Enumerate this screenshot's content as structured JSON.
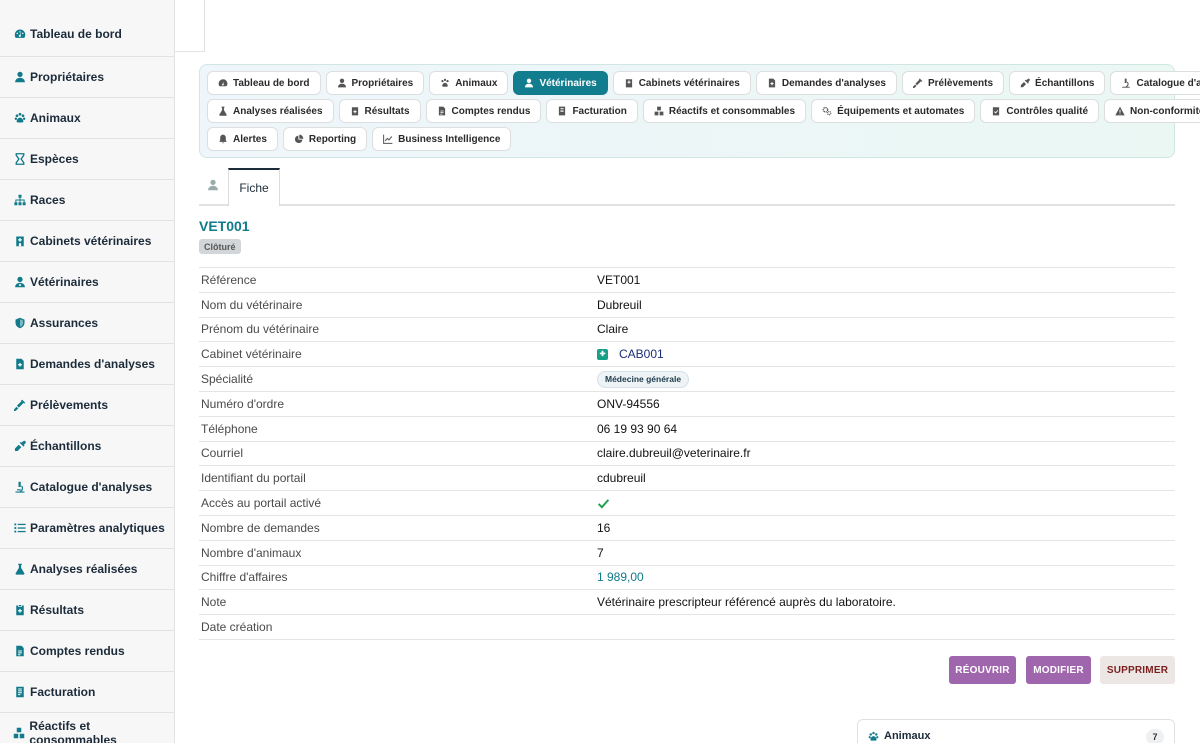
{
  "sidebar": {
    "items": [
      {
        "label": "Tableau de bord",
        "icon": "gauge-icon"
      },
      {
        "label": "Propriétaires",
        "icon": "user-icon"
      },
      {
        "label": "Animaux",
        "icon": "paw-icon"
      },
      {
        "label": "Espèces",
        "icon": "hourglass-icon"
      },
      {
        "label": "Races",
        "icon": "sitemap-icon"
      },
      {
        "label": "Cabinets vétérinaires",
        "icon": "clinic-icon"
      },
      {
        "label": "Vétérinaires",
        "icon": "user-doctor-icon"
      },
      {
        "label": "Assurances",
        "icon": "shield-icon"
      },
      {
        "label": "Demandes d'analyses",
        "icon": "file-medical-icon"
      },
      {
        "label": "Prélèvements",
        "icon": "syringe-icon"
      },
      {
        "label": "Échantillons",
        "icon": "eyedropper-icon"
      },
      {
        "label": "Catalogue d'analyses",
        "icon": "microscope-icon"
      },
      {
        "label": "Paramètres analytiques",
        "icon": "list-icon"
      },
      {
        "label": "Analyses réalisées",
        "icon": "flask-icon"
      },
      {
        "label": "Résultats",
        "icon": "file-result-icon"
      },
      {
        "label": "Comptes rendus",
        "icon": "file-report-icon"
      },
      {
        "label": "Facturation",
        "icon": "invoice-icon"
      },
      {
        "label": "Réactifs et consommables",
        "icon": "boxes-icon"
      }
    ]
  },
  "nav": {
    "rows": [
      [
        {
          "label": "Tableau de bord",
          "icon": "gauge-icon",
          "active": false
        },
        {
          "label": "Propriétaires",
          "icon": "user-icon",
          "active": false
        },
        {
          "label": "Animaux",
          "icon": "paw-icon",
          "active": false
        },
        {
          "label": "Vétérinaires",
          "icon": "user-doctor-icon",
          "active": true
        },
        {
          "label": "Cabinets vétérinaires",
          "icon": "clinic-icon",
          "active": false
        },
        {
          "label": "Demandes d'analyses",
          "icon": "file-medical-icon",
          "active": false
        },
        {
          "label": "Prélèvements",
          "icon": "syringe-icon",
          "active": false
        },
        {
          "label": "Échantillons",
          "icon": "eyedropper-icon",
          "active": false
        },
        {
          "label": "Catalogue d'analyses",
          "icon": "microscope-icon",
          "active": false
        }
      ],
      [
        {
          "label": "Analyses réalisées",
          "icon": "flask-icon",
          "active": false
        },
        {
          "label": "Résultats",
          "icon": "file-result-icon",
          "active": false
        },
        {
          "label": "Comptes rendus",
          "icon": "file-report-icon",
          "active": false
        },
        {
          "label": "Facturation",
          "icon": "invoice-icon",
          "active": false
        },
        {
          "label": "Réactifs et consommables",
          "icon": "boxes-icon",
          "active": false
        },
        {
          "label": "Équipements et automates",
          "icon": "gears-icon",
          "active": false
        },
        {
          "label": "Contrôles qualité",
          "icon": "clipboard-check-icon",
          "active": false
        },
        {
          "label": "Non-conformités",
          "icon": "warning-icon",
          "active": false
        }
      ],
      [
        {
          "label": "Alertes",
          "icon": "bell-icon",
          "active": false
        },
        {
          "label": "Reporting",
          "icon": "pie-chart-icon",
          "active": false
        },
        {
          "label": "Business Intelligence",
          "icon": "line-chart-icon",
          "active": false
        }
      ]
    ]
  },
  "tabs": {
    "fiche_label": "Fiche"
  },
  "record": {
    "title": "VET001",
    "status": "Clôturé",
    "fields": {
      "reference": {
        "label": "Référence",
        "value": "VET001"
      },
      "nom": {
        "label": "Nom du vétérinaire",
        "value": "Dubreuil"
      },
      "prenom": {
        "label": "Prénom du vétérinaire",
        "value": "Claire"
      },
      "cabinet": {
        "label": "Cabinet vétérinaire",
        "value": "CAB001"
      },
      "specialite": {
        "label": "Spécialité",
        "value": "Médecine générale"
      },
      "numero_ordre": {
        "label": "Numéro d'ordre",
        "value": "ONV-94556"
      },
      "telephone": {
        "label": "Téléphone",
        "value": "06 19 93 90 64"
      },
      "courriel": {
        "label": "Courriel",
        "value": "claire.dubreuil@veterinaire.fr"
      },
      "identifiant": {
        "label": "Identifiant du portail",
        "value": "cdubreuil"
      },
      "acces": {
        "label": "Accès au portail activé",
        "value": true
      },
      "nb_demandes": {
        "label": "Nombre de demandes",
        "value": "16"
      },
      "nb_animaux": {
        "label": "Nombre d'animaux",
        "value": "7"
      },
      "ca": {
        "label": "Chiffre d'affaires",
        "value": "1 989,00"
      },
      "note": {
        "label": "Note",
        "value": "Vétérinaire prescripteur référencé auprès du laboratoire."
      },
      "date_creation": {
        "label": "Date création",
        "value": ""
      }
    }
  },
  "actions": {
    "reopen": "RÉOUVRIR",
    "edit": "MODIFIER",
    "delete": "SUPPRIMER"
  },
  "card": {
    "title": "Animaux",
    "count": "7"
  },
  "colors": {
    "accent": "#117a8b",
    "active_pill": "#117d8f",
    "action_button": "#a066ad",
    "delete_text": "#7a1f1f"
  }
}
